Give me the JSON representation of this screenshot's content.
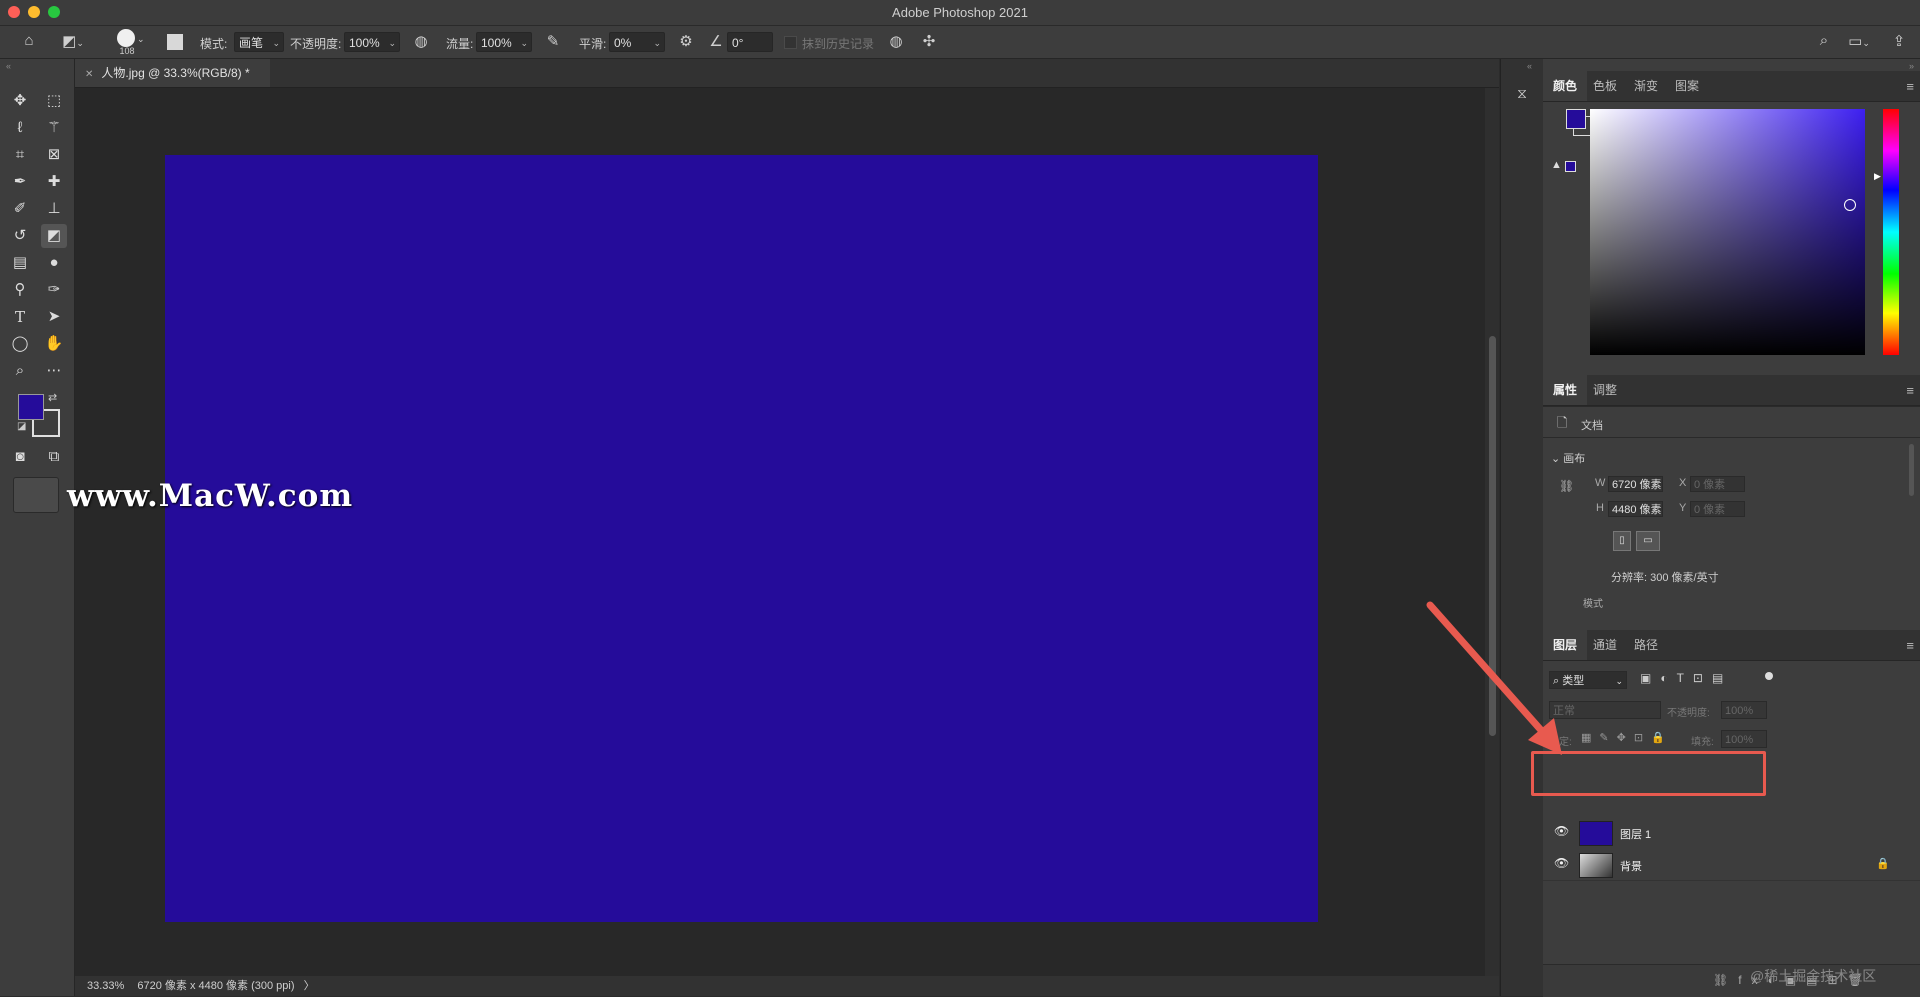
{
  "window": {
    "title": "Adobe Photoshop 2021"
  },
  "options": {
    "brush_size": "108",
    "mode_label": "模式:",
    "mode_value": "画笔",
    "opacity_label": "不透明度:",
    "opacity_value": "100%",
    "flow_label": "流量:",
    "flow_value": "100%",
    "smooth_label": "平滑:",
    "smooth_value": "0%",
    "angle_value": "0°",
    "erase_history_label": "抹到历史记录"
  },
  "document": {
    "tab_label": "人物.jpg @ 33.3%(RGB/8) *",
    "fill_color": "#250c9a",
    "watermark": "www.MacW.com"
  },
  "status": {
    "zoom": "33.33%",
    "info": "6720 像素 x 4480 像素 (300 ppi)"
  },
  "colors": {
    "foreground": "#250c9a",
    "background": "#ffffff",
    "accent": "#e85a4f"
  },
  "color_panel": {
    "tabs": [
      "颜色",
      "色板",
      "渐变",
      "图案"
    ],
    "active_tab": 0
  },
  "properties_panel": {
    "tabs": [
      "属性",
      "调整"
    ],
    "doc_label": "文档",
    "canvas_section": "画布",
    "w_label": "W",
    "w_value": "6720 像素",
    "h_label": "H",
    "h_value": "4480 像素",
    "x_label": "X",
    "x_value": "0 像素",
    "y_label": "Y",
    "y_value": "0 像素",
    "resolution": "分辨率: 300 像素/英寸",
    "mode_label": "模式"
  },
  "layers_panel": {
    "tabs": [
      "图层",
      "通道",
      "路径"
    ],
    "filter_label": "类型",
    "blend_mode": "正常",
    "opacity_label": "不透明度:",
    "opacity_value": "100%",
    "lock_label": "锁定:",
    "fill_label": "填充:",
    "fill_value": "100%",
    "layers": [
      {
        "name": "图层 1",
        "visible": true,
        "locked": false,
        "selected": true
      },
      {
        "name": "背景",
        "visible": true,
        "locked": true,
        "selected": false
      }
    ]
  },
  "footer_watermark": "@稀土掘金技术社区"
}
